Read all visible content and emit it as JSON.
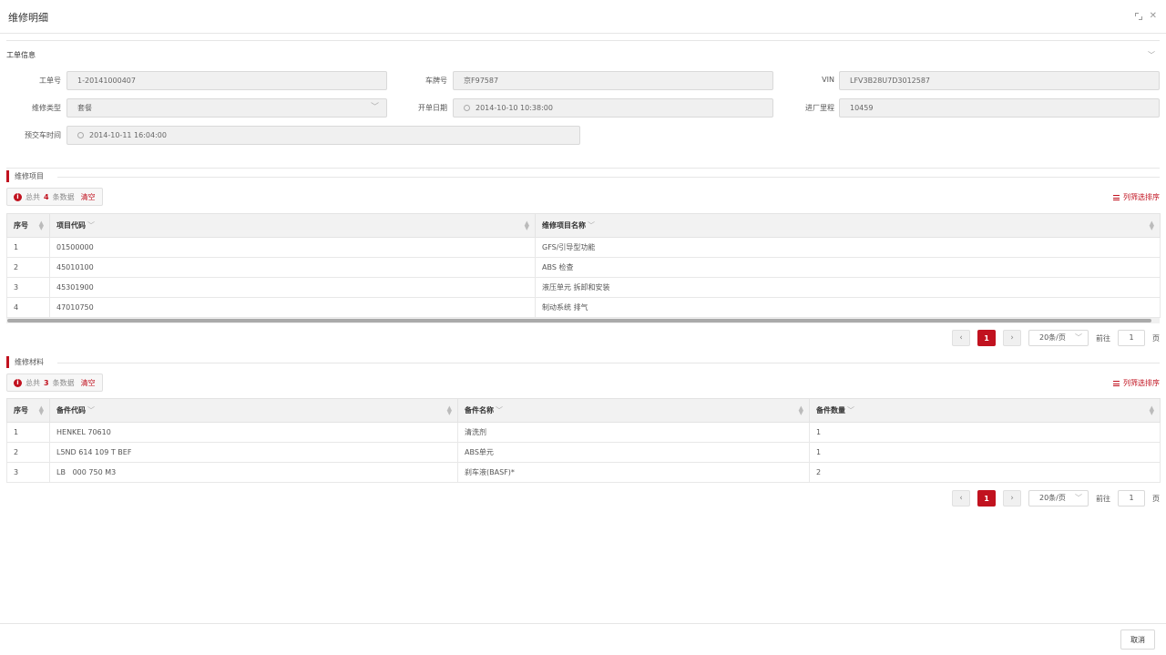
{
  "dialog": {
    "title": "维修明细",
    "cancel_label": "取消"
  },
  "work_order": {
    "section_title": "工单信息",
    "fields": {
      "order_no": {
        "label": "工单号",
        "value": "1-20141000407"
      },
      "plate_no": {
        "label": "车牌号",
        "value": "京F97587"
      },
      "vin": {
        "label": "VIN",
        "value": "LFV3B28U7D3012587"
      },
      "repair_type": {
        "label": "维修类型",
        "value": "套餐"
      },
      "open_date": {
        "label": "开单日期",
        "value": "2014-10-10 10:38:00"
      },
      "mileage": {
        "label": "进厂里程",
        "value": "10459"
      },
      "delivery_time": {
        "label": "预交车时间",
        "value": "2014-10-11 16:04:00"
      }
    }
  },
  "repair_items": {
    "title": "维修项目",
    "summary": {
      "prefix": "总共",
      "count": "4",
      "suffix": "条数据",
      "clear": "清空"
    },
    "column_filter": "列筛选排序",
    "columns": [
      "序号",
      "项目代码",
      "维修项目名称"
    ],
    "rows": [
      [
        "1",
        "01500000",
        "GFS/引导型功能"
      ],
      [
        "2",
        "45010100",
        "ABS 检查"
      ],
      [
        "3",
        "45301900",
        "液压单元 拆卸和安装"
      ],
      [
        "4",
        "47010750",
        "制动系统 排气"
      ]
    ]
  },
  "repair_materials": {
    "title": "维修材料",
    "summary": {
      "prefix": "总共",
      "count": "3",
      "suffix": "条数据",
      "clear": "清空"
    },
    "column_filter": "列筛选排序",
    "columns": [
      "序号",
      "备件代码",
      "备件名称",
      "备件数量"
    ],
    "rows": [
      [
        "1",
        "HENKEL 70610",
        "清洗剂",
        "1"
      ],
      [
        "2",
        "L5ND 614 109 T BEF",
        "ABS单元",
        "1"
      ],
      [
        "3",
        "LB   000 750 M3",
        "刹车液(BASF)*",
        "2"
      ]
    ]
  },
  "pagination": {
    "current_page": "1",
    "page_size": "20条/页",
    "goto_prefix": "前往",
    "goto_value": "1",
    "goto_suffix": "页"
  },
  "colors": {
    "accent": "#c1121f"
  }
}
